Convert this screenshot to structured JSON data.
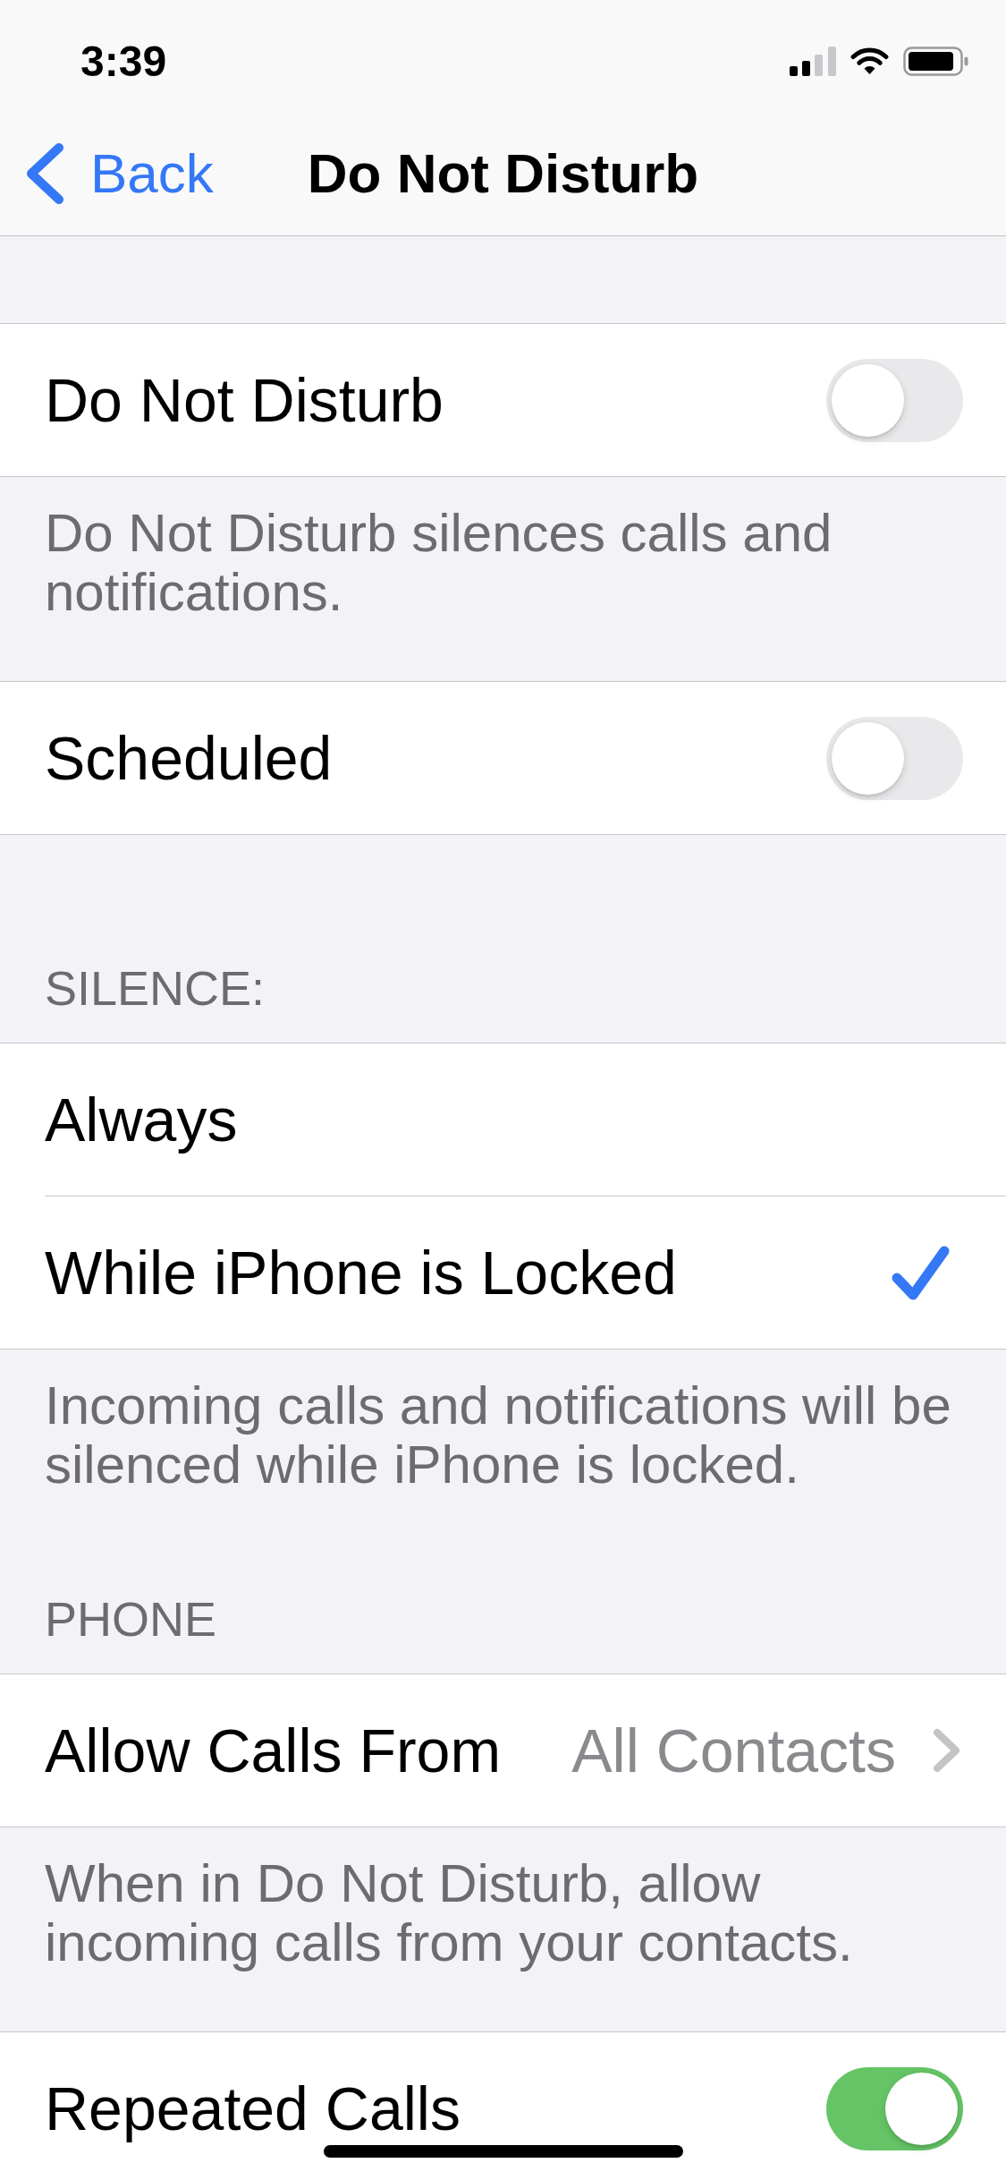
{
  "status_bar": {
    "time": "3:39"
  },
  "nav_bar": {
    "back_label": "Back",
    "title": "Do Not Disturb"
  },
  "sections": [
    {
      "rows": [
        {
          "kind": "toggle",
          "label": "Do Not Disturb",
          "on": false
        }
      ],
      "footer": "Do Not Disturb silences calls and notifications."
    },
    {
      "rows": [
        {
          "kind": "toggle",
          "label": "Scheduled",
          "on": false
        }
      ]
    },
    {
      "header": "SILENCE:",
      "rows": [
        {
          "kind": "option",
          "label": "Always",
          "selected": false
        },
        {
          "kind": "option",
          "label": "While iPhone is Locked",
          "selected": true
        }
      ],
      "footer": "Incoming calls and notifications will be silenced while iPhone is locked."
    },
    {
      "header": "PHONE",
      "rows": [
        {
          "kind": "link",
          "label": "Allow Calls From",
          "value": "All Contacts"
        }
      ],
      "footer": "When in Do Not Disturb, allow incoming calls from your contacts."
    },
    {
      "rows": [
        {
          "kind": "toggle",
          "label": "Repeated Calls",
          "on": true
        }
      ]
    }
  ]
}
